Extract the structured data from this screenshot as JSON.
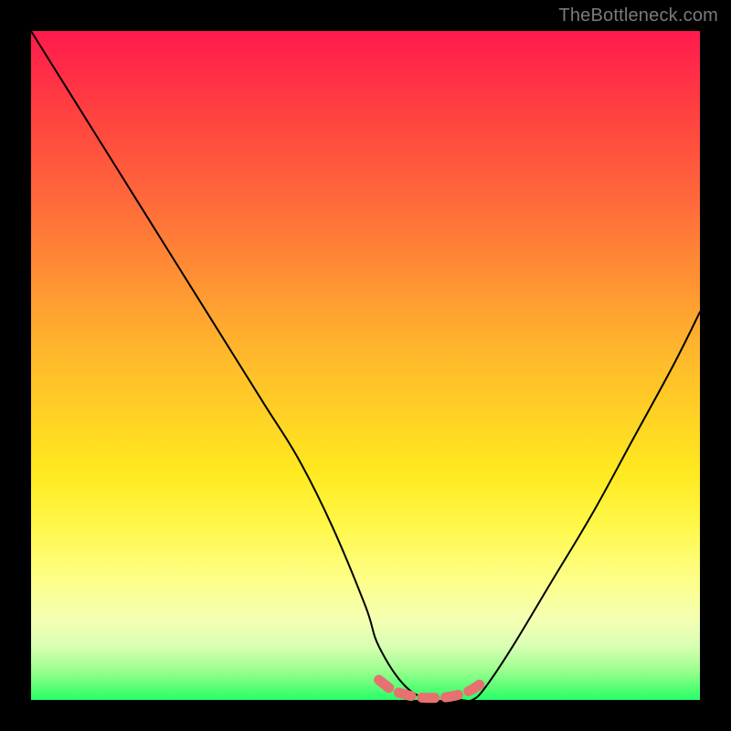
{
  "watermark": "TheBottleneck.com",
  "chart_data": {
    "type": "line",
    "title": "",
    "xlabel": "",
    "ylabel": "",
    "xlim": [
      0,
      100
    ],
    "ylim": [
      0,
      100
    ],
    "series": [
      {
        "name": "bottleneck-curve",
        "x": [
          0,
          5,
          10,
          15,
          20,
          25,
          30,
          35,
          40,
          45,
          50,
          52,
          56,
          60,
          64,
          66,
          68,
          72,
          78,
          84,
          90,
          96,
          100
        ],
        "values": [
          100,
          92,
          84,
          76,
          68,
          60,
          52,
          44,
          36,
          26,
          14,
          8,
          2,
          0,
          0,
          0,
          2,
          8,
          18,
          28,
          39,
          50,
          58
        ]
      },
      {
        "name": "highlight-band",
        "x": [
          52,
          54,
          56,
          58,
          60,
          62,
          64,
          66,
          68
        ],
        "values": [
          3,
          1.5,
          0.8,
          0.4,
          0.3,
          0.4,
          0.8,
          1.6,
          3
        ]
      }
    ],
    "colors": {
      "curve": "#000000",
      "highlight": "#e77070",
      "gradient_top": "#ff1a4d",
      "gradient_bottom": "#27ff69"
    }
  }
}
